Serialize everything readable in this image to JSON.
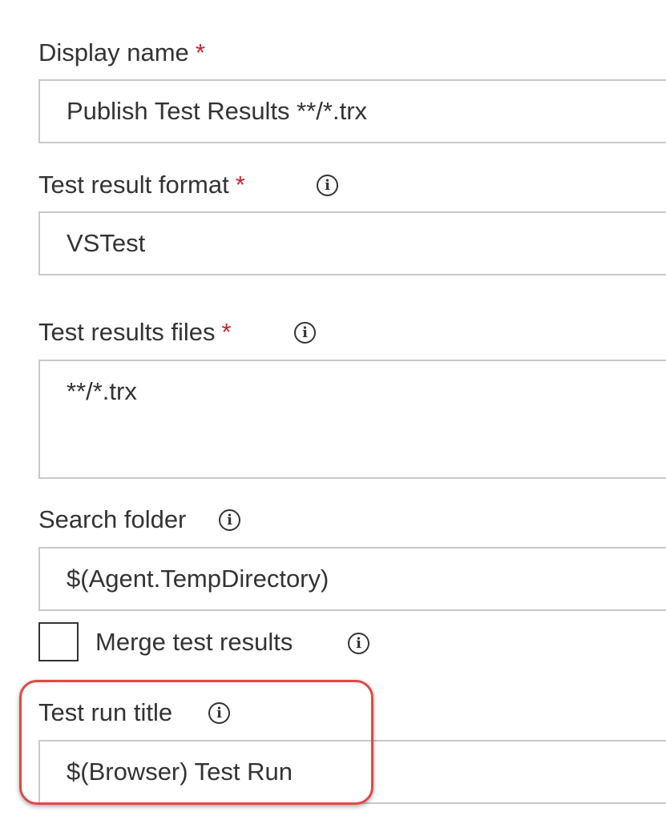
{
  "display_name": {
    "label": "Display name",
    "required_mark": "*",
    "value": "Publish Test Results **/*.trx"
  },
  "test_result_format": {
    "label": "Test result format",
    "required_mark": "*",
    "value": "VSTest"
  },
  "test_results_files": {
    "label": "Test results files",
    "required_mark": "*",
    "value": "**/*.trx"
  },
  "search_folder": {
    "label": "Search folder",
    "value": "$(Agent.TempDirectory)"
  },
  "merge_test_results": {
    "label": "Merge test results",
    "checked": false
  },
  "test_run_title": {
    "label": "Test run title",
    "value": "$(Browser) Test Run"
  },
  "info_glyph": "i",
  "colors": {
    "text": "#333333",
    "required": "#c4262e",
    "border": "#c8c8c8",
    "highlight": "#e04848"
  },
  "icons": [
    "info-icon",
    "required-asterisk"
  ]
}
